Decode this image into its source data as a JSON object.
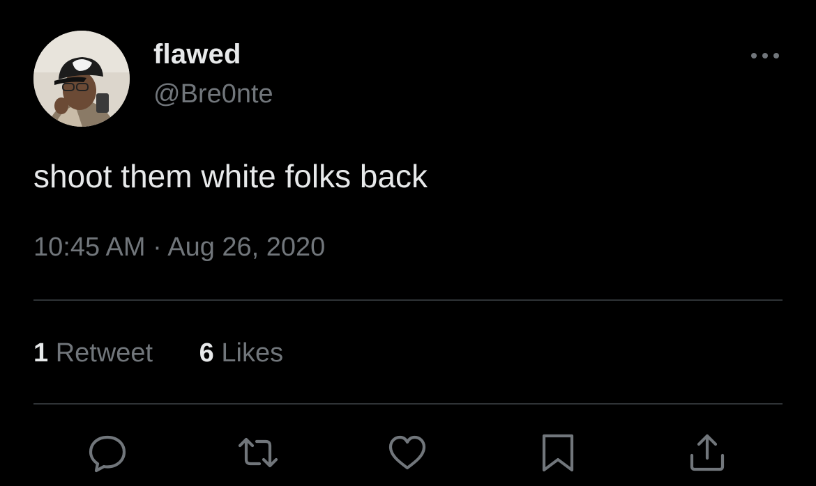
{
  "tweet": {
    "display_name": "flawed",
    "handle": "@Bre0nte",
    "text": "shoot them white folks back",
    "timestamp": "10:45 AM · Aug 26, 2020"
  },
  "stats": {
    "retweets_count": "1",
    "retweets_label": "Retweet",
    "likes_count": "6",
    "likes_label": "Likes"
  },
  "icons": {
    "more": "more-horizontal-icon",
    "reply": "reply-icon",
    "retweet": "retweet-icon",
    "like": "heart-icon",
    "bookmark": "bookmark-icon",
    "share": "share-icon"
  },
  "colors": {
    "background": "#000000",
    "primary_text": "#e7e9ea",
    "secondary_text": "#71767b",
    "divider": "#2f3336"
  }
}
